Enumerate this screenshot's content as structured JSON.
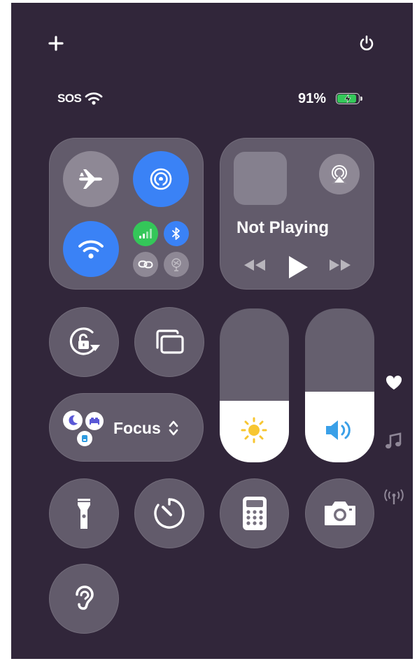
{
  "status_bar": {
    "carrier": "SOS",
    "battery_percent": "91%",
    "battery_level": 0.91
  },
  "top_actions": {
    "add_icon": "plus-icon",
    "power_icon": "power-icon"
  },
  "connectivity": {
    "airplane_mode": {
      "icon": "airplane-icon",
      "on": false
    },
    "airdrop": {
      "icon": "airdrop-icon",
      "on": true,
      "color": "#3a82f6"
    },
    "wifi": {
      "icon": "wifi-icon",
      "on": true,
      "color": "#3a82f6"
    },
    "cellular": {
      "icon": "cellular-icon",
      "on": true,
      "color": "#34c759"
    },
    "bluetooth": {
      "icon": "bluetooth-icon",
      "on": true,
      "color": "#3a82f6"
    },
    "personal_hotspot": {
      "icon": "link-icon",
      "on": false
    },
    "satellite": {
      "icon": "satellite-icon",
      "on": false
    }
  },
  "now_playing": {
    "title": "Not Playing",
    "airplay_icon": "airplay-icon"
  },
  "controls": {
    "orientation_lock": {
      "icon": "rotation-lock-icon"
    },
    "screen_mirroring": {
      "icon": "screen-mirroring-icon"
    },
    "focus": {
      "label": "Focus",
      "chevron_icon": "updown-chevron-icon"
    },
    "brightness": {
      "icon": "sun-icon",
      "level": 0.4
    },
    "volume": {
      "icon": "speaker-icon",
      "level": 0.46
    },
    "flashlight": {
      "icon": "flashlight-icon"
    },
    "timer": {
      "icon": "timer-icon"
    },
    "calculator": {
      "icon": "calculator-icon"
    },
    "camera": {
      "icon": "camera-icon"
    },
    "hearing": {
      "icon": "ear-icon"
    }
  },
  "page_indicators": [
    {
      "icon": "heart-icon",
      "active": true
    },
    {
      "icon": "music-note-icon",
      "active": false
    },
    {
      "icon": "antenna-icon",
      "active": false
    }
  ],
  "colors": {
    "background": "#31263a",
    "accent_blue": "#3a82f6",
    "green": "#34c759",
    "sun_yellow": "#f7c631"
  }
}
